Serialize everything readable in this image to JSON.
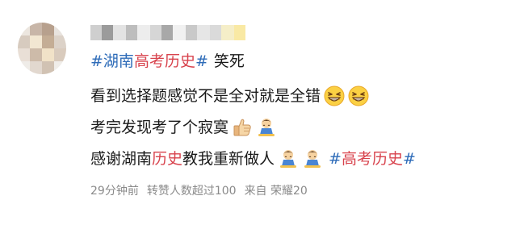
{
  "comment": {
    "author_avatar": "pixelated-avatar",
    "author_name_blurred": true,
    "line1": {
      "hashtag_prefix": "#",
      "hashtag_blue1": "湖南",
      "hashtag_red": "高考历史",
      "hashtag_suffix": "#",
      "text": "笑死"
    },
    "line2": {
      "text": "看到选择题感觉不是全对就是全错",
      "emojis": [
        "grinning-face-icon",
        "grinning-face-icon"
      ]
    },
    "line3": {
      "text": "考完发现考了个寂寞",
      "emojis": [
        "thumbs-up-icon",
        "sitting-doll-icon"
      ]
    },
    "line4": {
      "text_before": "感谢湖南",
      "text_red": "历史",
      "text_after": "教我重新做人",
      "emojis": [
        "sitting-doll-icon",
        "sitting-doll-icon"
      ],
      "hashtag_prefix": "#",
      "hashtag_red": "高考历史",
      "hashtag_suffix": "#"
    },
    "meta": {
      "time": "29分钟前",
      "reposts": "转赞人数超过100",
      "source": "来自 荣耀20"
    }
  },
  "colors": {
    "hashtag_blue": "#2d6bb8",
    "highlight_red": "#d8434d",
    "meta_gray": "#8a8a8a",
    "text": "#1a1a1a"
  }
}
